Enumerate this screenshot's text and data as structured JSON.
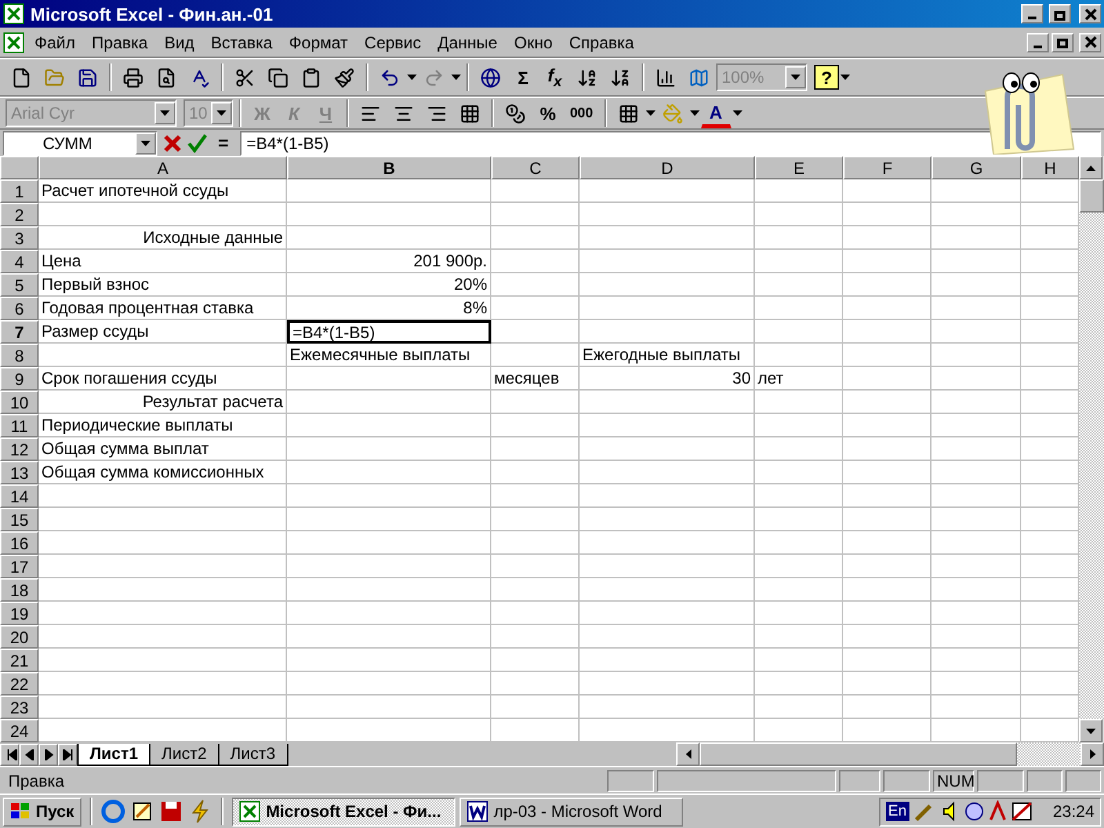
{
  "window": {
    "title": "Microsoft Excel - Фин.ан.-01"
  },
  "menu": [
    "Файл",
    "Правка",
    "Вид",
    "Вставка",
    "Формат",
    "Сервис",
    "Данные",
    "Окно",
    "Справка"
  ],
  "standard_toolbar": {
    "sum": "Σ",
    "function": "f$_{x}$",
    "zoom": {
      "value": "100%",
      "disabled": true
    },
    "help": "?",
    "redo": {
      "disabled": true
    }
  },
  "format_toolbar": {
    "font": {
      "value": "Arial Cyr",
      "disabled": true
    },
    "size": {
      "value": "10",
      "disabled": true
    },
    "styles": [
      {
        "label": "Ж",
        "disabled": true
      },
      {
        "label": "К",
        "disabled": true
      },
      {
        "label": "Ч",
        "disabled": true
      }
    ],
    "percent": "%",
    "thousands": "000",
    "font_color": "A"
  },
  "formula_bar": {
    "name_box": "СУММ",
    "equals": "=",
    "formula": "=B4*(1-B5)"
  },
  "sheet": {
    "columns": [
      {
        "label": "A",
        "selected": false
      },
      {
        "label": "B",
        "selected": true
      },
      {
        "label": "C",
        "selected": false
      },
      {
        "label": "D",
        "selected": false
      },
      {
        "label": "E",
        "selected": false
      },
      {
        "label": "F",
        "selected": false
      },
      {
        "label": "G",
        "selected": false
      },
      {
        "label": "H",
        "selected": false
      }
    ],
    "rows": [
      {
        "label": "1",
        "selected": false,
        "cells": [
          {
            "text": "Расчет ипотечной ссуды",
            "right_aligned": false,
            "selected": false
          }
        ]
      },
      {
        "label": "2",
        "selected": false
      },
      {
        "label": "3",
        "selected": false,
        "cells": [
          {
            "text": "Исходные данные",
            "right_aligned": true,
            "selected": false
          }
        ]
      },
      {
        "label": "4",
        "selected": false,
        "cells": [
          {
            "text": "Цена",
            "right_aligned": false,
            "selected": false
          },
          {
            "text": "201 900р.",
            "right_aligned": true,
            "selected": false
          }
        ]
      },
      {
        "label": "5",
        "selected": false,
        "cells": [
          {
            "text": "Первый взнос",
            "right_aligned": false,
            "selected": false
          },
          {
            "text": "20%",
            "right_aligned": true,
            "selected": false
          }
        ]
      },
      {
        "label": "6",
        "selected": false,
        "cells": [
          {
            "text": "Годовая процентная ставка",
            "right_aligned": false,
            "selected": false
          },
          {
            "text": "8%",
            "right_aligned": true,
            "selected": false
          }
        ]
      },
      {
        "label": "7",
        "selected": true,
        "cells": [
          {
            "text": "Размер ссуды",
            "right_aligned": false,
            "selected": false
          },
          {
            "text": "=B4*(1-B5)",
            "right_aligned": false,
            "selected": true
          }
        ]
      },
      {
        "label": "8",
        "selected": false,
        "cells": [
          null,
          {
            "text": "Ежемесячные выплаты",
            "right_aligned": false,
            "selected": false
          },
          null,
          {
            "text": "Ежегодные выплаты",
            "right_aligned": false,
            "selected": false
          }
        ]
      },
      {
        "label": "9",
        "selected": false,
        "cells": [
          {
            "text": "Срок погашения ссуды",
            "right_aligned": false,
            "selected": false
          },
          null,
          {
            "text": "месяцев",
            "right_aligned": false,
            "selected": false
          },
          {
            "text": "30",
            "right_aligned": true,
            "selected": false
          },
          {
            "text": "лет",
            "right_aligned": false,
            "selected": false
          }
        ]
      },
      {
        "label": "10",
        "selected": false,
        "cells": [
          {
            "text": "Результат расчета",
            "right_aligned": true,
            "selected": false
          }
        ]
      },
      {
        "label": "11",
        "selected": false,
        "cells": [
          {
            "text": "Периодические выплаты",
            "right_aligned": false,
            "selected": false
          }
        ]
      },
      {
        "label": "12",
        "selected": false,
        "cells": [
          {
            "text": "Общая сумма выплат",
            "right_aligned": false,
            "selected": false
          }
        ]
      },
      {
        "label": "13",
        "selected": false,
        "cells": [
          {
            "text": "Общая сумма комиссионных",
            "right_aligned": false,
            "selected": false
          }
        ]
      },
      {
        "label": "14",
        "selected": false
      },
      {
        "label": "15",
        "selected": false
      },
      {
        "label": "16",
        "selected": false
      },
      {
        "label": "17",
        "selected": false
      },
      {
        "label": "18",
        "selected": false
      },
      {
        "label": "19",
        "selected": false
      },
      {
        "label": "20",
        "selected": false
      },
      {
        "label": "21",
        "selected": false
      },
      {
        "label": "22",
        "selected": false
      },
      {
        "label": "23",
        "selected": false
      },
      {
        "label": "24",
        "selected": false
      }
    ]
  },
  "sheet_tabs": [
    {
      "label": "Лист1",
      "selected": true
    },
    {
      "label": "Лист2",
      "selected": false
    },
    {
      "label": "Лист3",
      "selected": false
    }
  ],
  "status_bar": {
    "mode": "Правка",
    "indicators": [
      "NUM"
    ]
  },
  "taskbar": {
    "start": "Пуск",
    "tasks": [
      {
        "label": "Microsoft Excel - Фи...",
        "selected": true
      },
      {
        "label": "лр-03 - Microsoft Word",
        "selected": false
      }
    ],
    "language": "En",
    "clock": "23:24"
  }
}
